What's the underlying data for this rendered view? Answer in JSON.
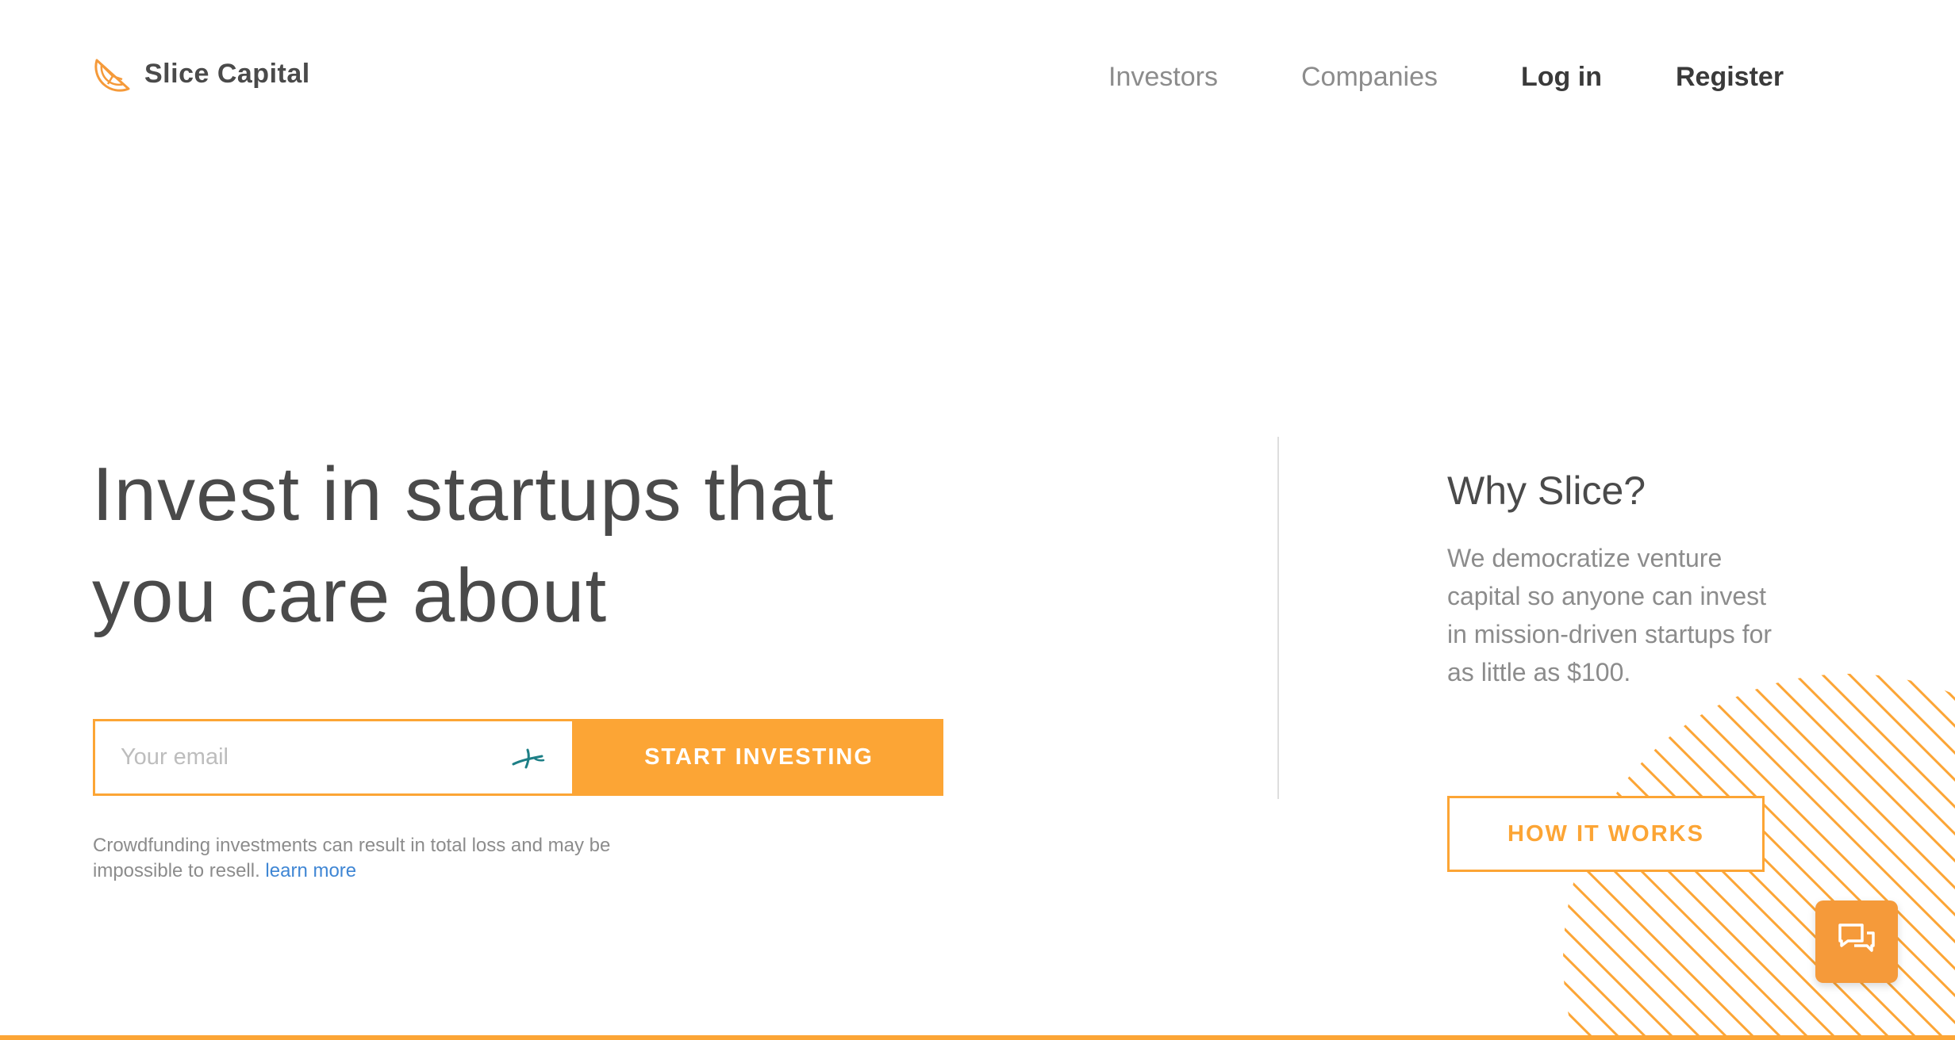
{
  "brand": {
    "name": "Slice Capital",
    "logo_icon": "orange-slice-icon"
  },
  "nav": {
    "investors": "Investors",
    "companies": "Companies",
    "login": "Log in",
    "register": "Register"
  },
  "hero": {
    "title_line1": "Invest in startups that",
    "title_line2": "you care about",
    "email_placeholder": "Your email",
    "email_value": "",
    "autofill_icon": "password-manager-icon",
    "cta_label": "START INVESTING",
    "disclaimer": "Crowdfunding investments can result in total loss and may be impossible to resell.",
    "learn_more": "learn more"
  },
  "why": {
    "title": "Why Slice?",
    "text": "We democratize venture capital so anyone can invest in mission-driven startups for as little as $100.",
    "button": "HOW IT WORKS"
  },
  "chat": {
    "icon": "chat-bubbles-icon"
  },
  "colors": {
    "accent": "#fca535",
    "text_dark": "#4a4a4a",
    "text_muted": "#8c8c8c",
    "link": "#3f86d4"
  }
}
